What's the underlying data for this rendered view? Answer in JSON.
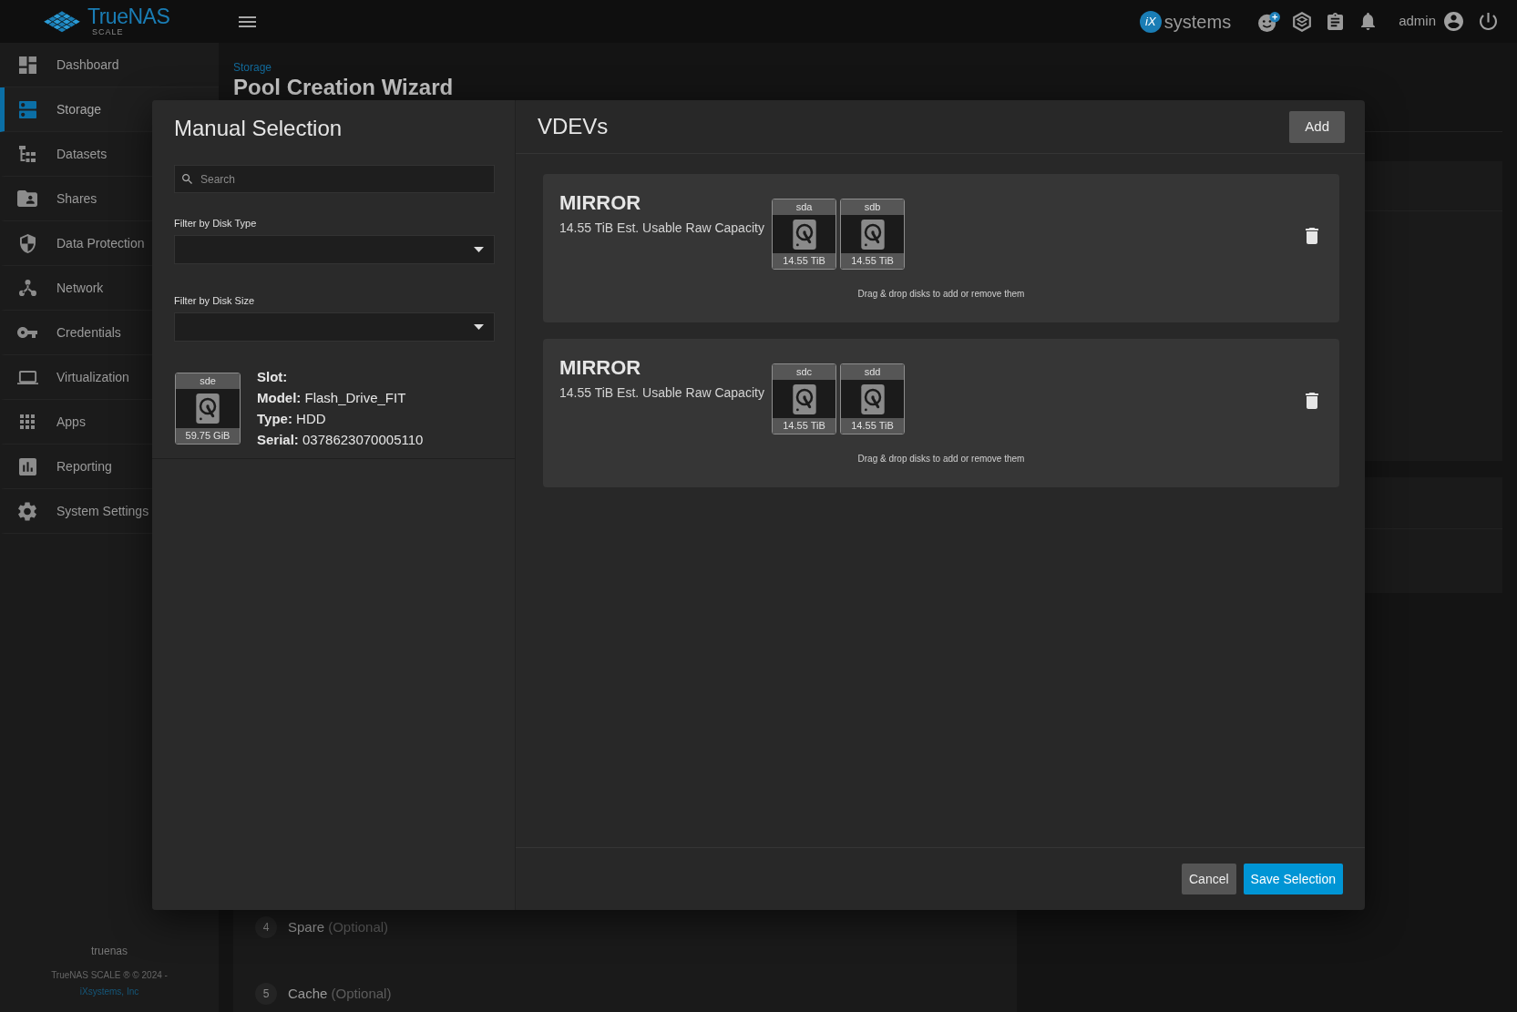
{
  "header": {
    "logo": {
      "name": "TrueNAS",
      "edition": "SCALE"
    },
    "vendor": {
      "mark": "iX",
      "name": "systems"
    },
    "user": "admin"
  },
  "sidebar": {
    "items": [
      {
        "label": "Dashboard",
        "selected": false
      },
      {
        "label": "Storage",
        "selected": true
      },
      {
        "label": "Datasets",
        "selected": false
      },
      {
        "label": "Shares",
        "selected": false
      },
      {
        "label": "Data Protection",
        "selected": false
      },
      {
        "label": "Network",
        "selected": false
      },
      {
        "label": "Credentials",
        "selected": false
      },
      {
        "label": "Virtualization",
        "selected": false
      },
      {
        "label": "Apps",
        "selected": false
      },
      {
        "label": "Reporting",
        "selected": false
      },
      {
        "label": "System Settings",
        "selected": false
      }
    ],
    "hostname": "truenas",
    "copyright": "TrueNAS SCALE ® © 2024 -",
    "company": "iXsystems, Inc"
  },
  "page": {
    "breadcrumb": "Storage",
    "title": "Pool Creation Wizard",
    "steps": [
      {
        "number": "4",
        "label": "Spare",
        "note": "(Optional)"
      },
      {
        "number": "5",
        "label": "Cache",
        "note": "(Optional)"
      }
    ]
  },
  "dialog": {
    "title": "Manual Selection",
    "search": {
      "placeholder": "Search"
    },
    "filters": [
      {
        "label": "Filter by Disk Type"
      },
      {
        "label": "Filter by Disk Size"
      }
    ],
    "disks": [
      {
        "name": "sde",
        "size": "59.75 GiB",
        "details": [
          {
            "label": "Slot:"
          },
          {
            "label": "Model:",
            "value": "Flash_Drive_FIT"
          },
          {
            "label": "Type:",
            "value": "HDD"
          },
          {
            "label": "Serial:",
            "value": "0378623070005110"
          }
        ]
      }
    ],
    "vdevs_title": "VDEVs",
    "add_button": "Add",
    "vdevs": [
      {
        "type": "MIRROR",
        "capacity": "14.55 TiB Est. Usable Raw Capacity",
        "disks": [
          {
            "name": "sda",
            "size": "14.55 TiB"
          },
          {
            "name": "sdb",
            "size": "14.55 TiB"
          }
        ],
        "hint": "Drag & drop disks to add or remove them"
      },
      {
        "type": "MIRROR",
        "capacity": "14.55 TiB Est. Usable Raw Capacity",
        "disks": [
          {
            "name": "sdc",
            "size": "14.55 TiB"
          },
          {
            "name": "sdd",
            "size": "14.55 TiB"
          }
        ],
        "hint": "Drag & drop disks to add or remove them"
      }
    ],
    "buttons": [
      {
        "label": "Cancel",
        "kind": "secondary"
      },
      {
        "label": "Save Selection",
        "kind": "primary"
      }
    ]
  }
}
